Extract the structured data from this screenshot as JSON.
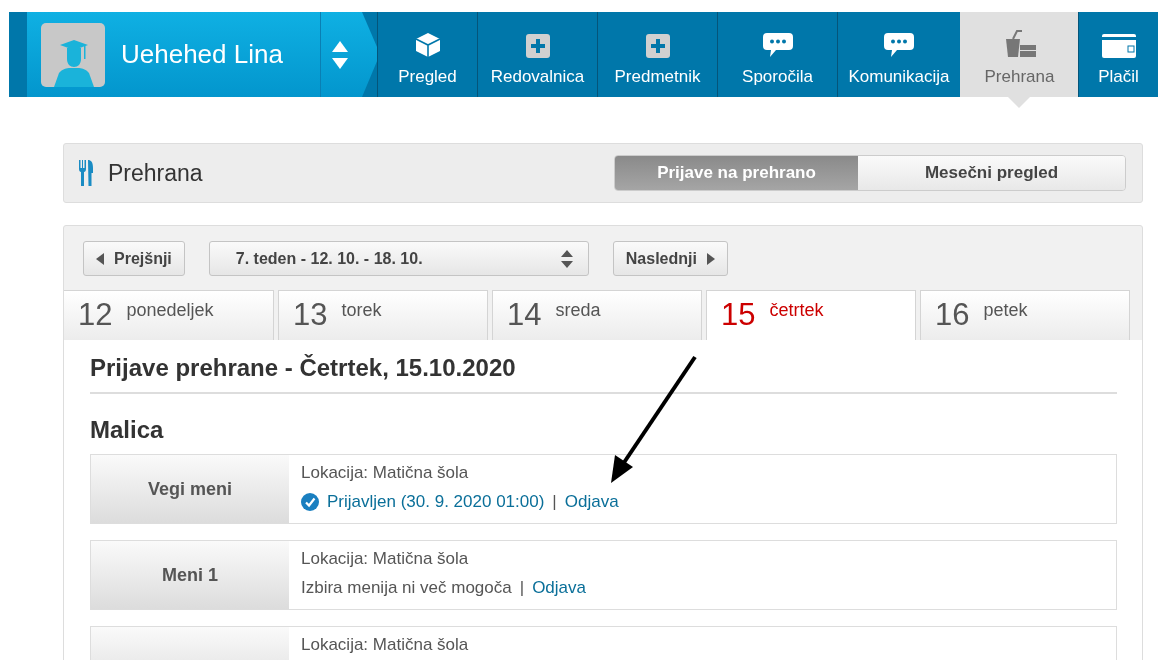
{
  "profile": {
    "name": "Uehehed Lina"
  },
  "nav": [
    {
      "label": "Pregled",
      "kind": "cube",
      "selected": false
    },
    {
      "label": "Redovalnica",
      "kind": "plus",
      "selected": false
    },
    {
      "label": "Predmetnik",
      "kind": "plus",
      "selected": false
    },
    {
      "label": "Sporočila",
      "kind": "chat",
      "selected": false
    },
    {
      "label": "Komunikacija",
      "kind": "chat",
      "selected": false
    },
    {
      "label": "Prehrana",
      "kind": "food",
      "selected": true
    },
    {
      "label": "Plačil",
      "kind": "card",
      "selected": false
    }
  ],
  "section": {
    "title": "Prehrana",
    "views": [
      {
        "label": "Prijave na prehrano",
        "selected": true
      },
      {
        "label": "Mesečni pregled",
        "selected": false
      }
    ]
  },
  "week": {
    "previous": "Prejšnji",
    "current": "7. teden - 12. 10. - 18. 10.",
    "next": "Naslednji"
  },
  "days": [
    {
      "number": "12",
      "name": "ponedeljek",
      "selected": false
    },
    {
      "number": "13",
      "name": "torek",
      "selected": false
    },
    {
      "number": "14",
      "name": "sreda",
      "selected": false
    },
    {
      "number": "15",
      "name": "četrtek",
      "selected": true
    },
    {
      "number": "16",
      "name": "petek",
      "selected": false
    }
  ],
  "heading": "Prijave prehrane - Četrtek, 15.10.2020",
  "meal": {
    "title": "Malica",
    "menus": [
      {
        "name": "Vegi meni",
        "location": "Lokacija: Matična šola",
        "status": {
          "kind": "registered",
          "text": "Prijavljen (30. 9. 2020 01:00)",
          "separator": "|",
          "action": "Odjava"
        }
      },
      {
        "name": "Meni 1",
        "location": "Lokacija: Matična šola",
        "status": {
          "kind": "locked",
          "text": "Izbira menija ni več mogoča",
          "separator": "|",
          "action": "Odjava"
        }
      },
      {
        "location": "Lokacija: Matična šola"
      }
    ]
  }
}
